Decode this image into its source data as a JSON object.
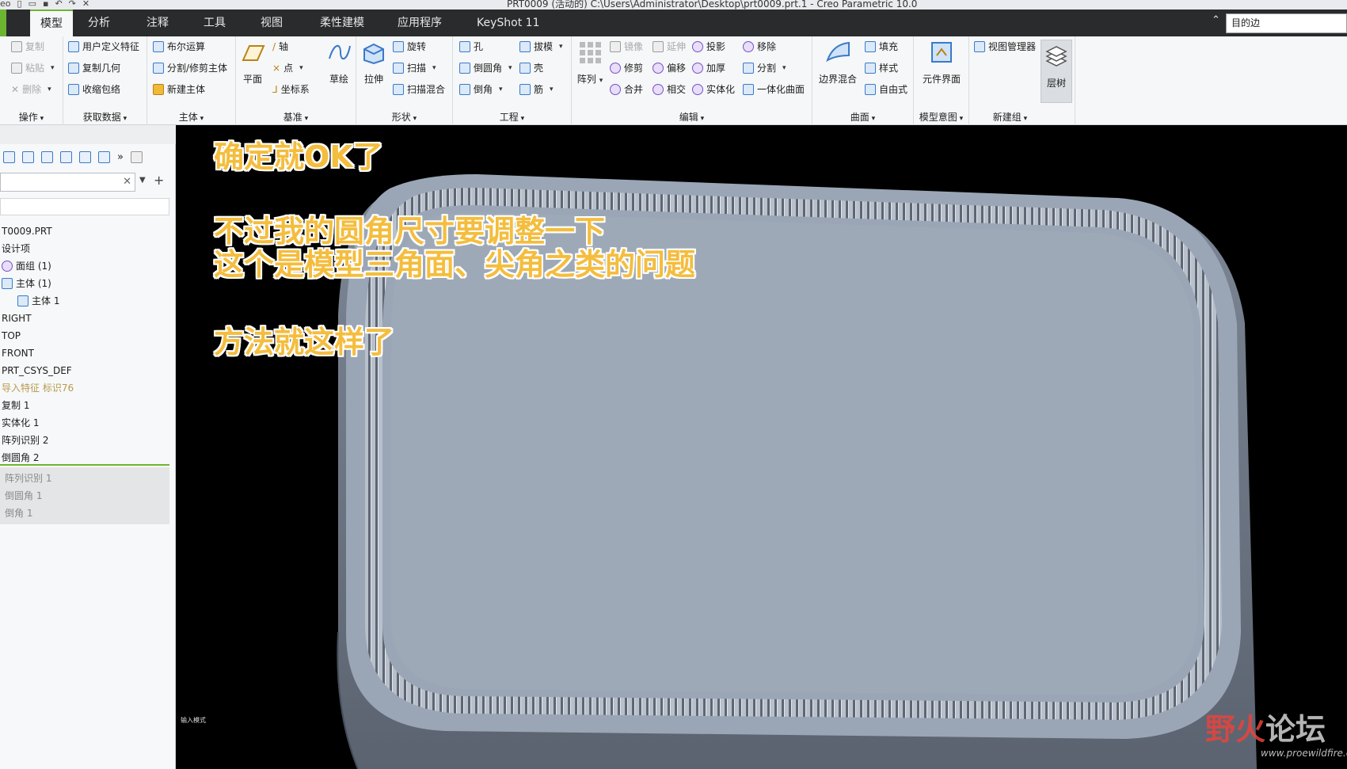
{
  "window": {
    "title": "PRT0009 (活动的) C:\\Users\\Administrator\\Desktop\\prt0009.prt.1 - Creo Parametric 10.0",
    "app_prefix": "eo"
  },
  "tabs": [
    "模型",
    "分析",
    "注释",
    "工具",
    "视图",
    "柔性建模",
    "应用程序",
    "KeyShot 11"
  ],
  "search": {
    "value": "目的边"
  },
  "ribbon": {
    "groups": {
      "ops": "操作",
      "getdata": "获取数据",
      "body": "主体",
      "datum": "基准",
      "shape": "形状",
      "eng": "工程",
      "edit": "编辑",
      "surface": "曲面",
      "intent": "模型意图",
      "newgroup": "新建组"
    },
    "items": {
      "copy": "复制",
      "paste": "粘贴",
      "delete": "删除",
      "udf": "用户定义特征",
      "copygeom": "复制几何",
      "shrinkwrap": "收缩包络",
      "boolean": "布尔运算",
      "split": "分割/修剪主体",
      "newbody": "新建主体",
      "plane": "平面",
      "axis": "轴",
      "point": "点",
      "csys": "坐标系",
      "sketch": "草绘",
      "extrude": "拉伸",
      "revolve": "旋转",
      "sweep": "扫描",
      "sweepblend": "扫描混合",
      "hole": "孔",
      "round": "倒圆角",
      "chamfer": "倒角",
      "draft": "拔模",
      "shell": "壳",
      "rib": "筋",
      "pattern": "阵列",
      "mirror": "镜像",
      "extend": "延伸",
      "project": "投影",
      "remove": "移除",
      "trim": "修剪",
      "offset": "偏移",
      "thicken": "加厚",
      "splitedit": "分割",
      "merge": "合并",
      "intersect": "相交",
      "solidify": "实体化",
      "unify": "一体化曲面",
      "boundary": "边界混合",
      "fill": "填充",
      "style": "样式",
      "freestyle": "自由式",
      "compint": "元件界面",
      "viewmgr": "视图管理器",
      "layertree": "层树"
    }
  },
  "tree": {
    "nodes": [
      "T0009.PRT",
      "设计项",
      "面组 (1)",
      "主体 (1)",
      "主体 1",
      "RIGHT",
      "TOP",
      "FRONT",
      "PRT_CSYS_DEF",
      "导入特征 标识76",
      "复制 1",
      "实体化 1",
      "阵列识别 2",
      "倒圆角 2"
    ],
    "suppressed": [
      "阵列识别 1",
      "倒圆角 1",
      "倒角 1"
    ]
  },
  "annotations": {
    "line1": "确定就OK了",
    "line2": "不过我的圆角尺寸要调整一下",
    "line3": "这个是模型三角面、尖角之类的问题",
    "line4": "方法就这样了"
  },
  "viewport": {
    "corner_label": "输入模式"
  },
  "watermark": {
    "part1": "野火",
    "part2": "论坛",
    "url": "www.proewildfire.cn"
  },
  "colors": {
    "accent": "#6cb531",
    "annotation": "#f4bd3d",
    "model": "#9aa6b5"
  }
}
